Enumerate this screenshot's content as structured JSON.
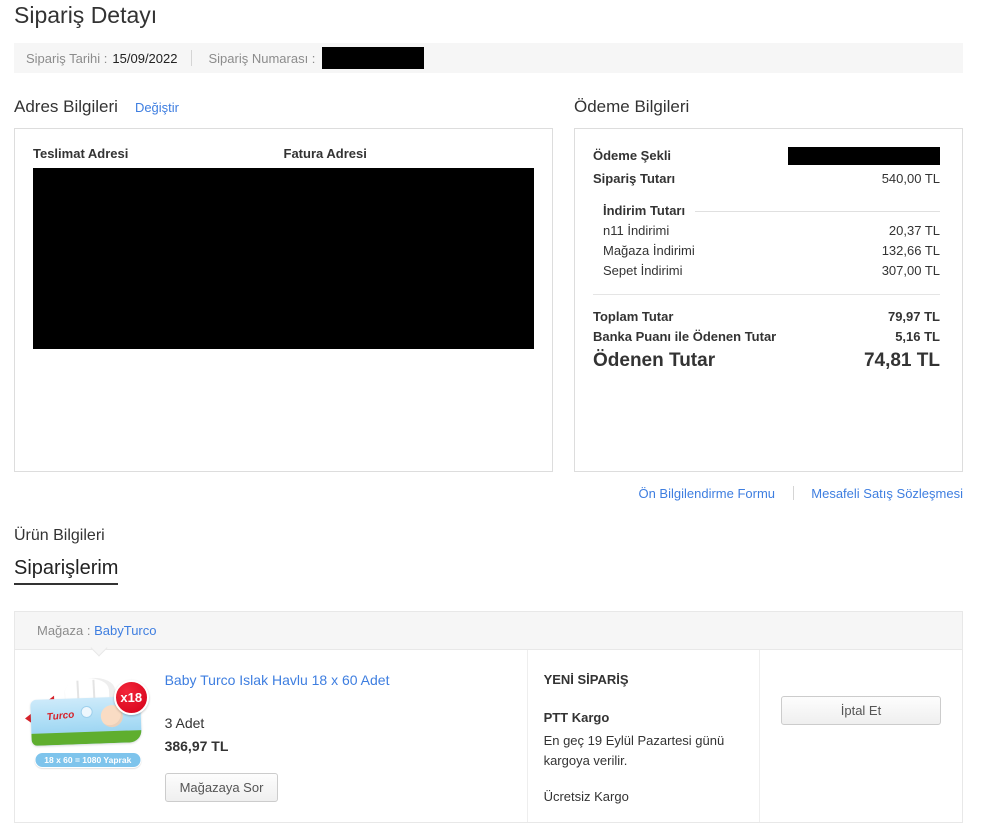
{
  "page": {
    "title": "Sipariş Detayı"
  },
  "order_bar": {
    "date_label": "Sipariş Tarihi :",
    "date_value": "15/09/2022",
    "number_label": "Sipariş Numarası :"
  },
  "address": {
    "heading": "Adres Bilgileri",
    "change_link": "Değiştir",
    "delivery_header": "Teslimat Adresi",
    "invoice_header": "Fatura Adresi"
  },
  "payment": {
    "heading": "Ödeme Bilgileri",
    "method_label": "Ödeme Şekli",
    "order_total_label": "Sipariş Tutarı",
    "order_total_value": "540,00 TL",
    "discount_heading": "İndirim Tutarı",
    "discounts": [
      {
        "label": "n11 İndirimi",
        "value": "20,37 TL"
      },
      {
        "label": "Mağaza İndirimi",
        "value": "132,66 TL"
      },
      {
        "label": "Sepet İndirimi",
        "value": "307,00 TL"
      }
    ],
    "total_label": "Toplam Tutar",
    "total_value": "79,97 TL",
    "bank_points_label": "Banka Puanı ile Ödenen Tutar",
    "bank_points_value": "5,16 TL",
    "paid_label": "Ödenen Tutar",
    "paid_value": "74,81 TL"
  },
  "contracts": {
    "pre_info_link": "Ön Bilgilendirme Formu",
    "distance_sales_link": "Mesafeli Satış Sözleşmesi"
  },
  "products": {
    "heading": "Ürün Bilgileri",
    "tab_label": "Siparişlerim",
    "store_label": "Mağaza :",
    "store_name": "BabyTurco",
    "item": {
      "title": "Baby Turco Islak Havlu 18 x 60 Adet",
      "quantity": "3 Adet",
      "price": "386,97 TL",
      "ask_store_button": "Mağazaya Sor",
      "status": "YENİ SİPARİŞ",
      "cargo_company": "PTT Kargo",
      "cargo_note": "En geç 19 Eylül Pazartesi günü kargoya verilir.",
      "free_shipping": "Ücretsiz Kargo",
      "cancel_button": "İptal Et",
      "image_badge": "x18",
      "image_pack_info": "18 x 60 = 1080 Yaprak",
      "image_logo": "Turco"
    }
  },
  "colors": {
    "link_blue": "#3e7ee0",
    "text": "#333333",
    "muted_gray": "#8c8c8c",
    "bar_background": "#f6f6f6",
    "border": "#dddddd",
    "badge_red": "#d40018",
    "pill_blue": "#7ec4ec",
    "redaction_black": "#000000"
  }
}
